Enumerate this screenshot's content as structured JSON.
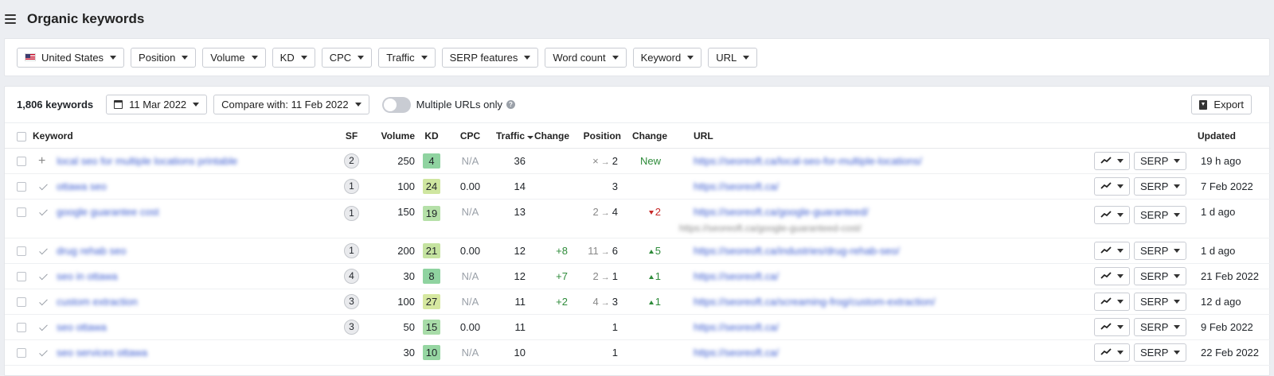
{
  "header": {
    "title": "Organic keywords"
  },
  "filters": [
    {
      "label": "United States",
      "icon": "us-flag-icon"
    },
    {
      "label": "Position"
    },
    {
      "label": "Volume"
    },
    {
      "label": "KD"
    },
    {
      "label": "CPC"
    },
    {
      "label": "Traffic"
    },
    {
      "label": "SERP features"
    },
    {
      "label": "Word count"
    },
    {
      "label": "Keyword"
    },
    {
      "label": "URL"
    }
  ],
  "toolbar": {
    "keyword_count": "1,806 keywords",
    "date": "11 Mar 2022",
    "compare": "Compare with: 11 Feb 2022",
    "multiple_urls_label": "Multiple URLs only",
    "multiple_urls_on": false,
    "export_label": "Export"
  },
  "columns": {
    "keyword": "Keyword",
    "sf": "SF",
    "volume": "Volume",
    "kd": "KD",
    "cpc": "CPC",
    "traffic": "Traffic",
    "traffic_change": "Change",
    "position": "Position",
    "position_change": "Change",
    "url": "URL",
    "updated": "Updated"
  },
  "row_actions": {
    "serp_label": "SERP"
  },
  "rows": [
    {
      "marker": "plus",
      "keyword": "local seo for multiple locations printable",
      "sf": "2",
      "volume": "250",
      "kd": "4",
      "kd_color": "#8fd3a0",
      "cpc": "N/A",
      "traffic": "36",
      "traffic_change": "",
      "pos_from": "×",
      "pos_to": "2",
      "pos_change": "New",
      "pos_dir": "new",
      "url": "https://seoreoft.ca/local-seo-for-multiple-locations/",
      "sub_url": "",
      "updated": "19 h ago"
    },
    {
      "marker": "check",
      "keyword": "ottawa seo",
      "sf": "1",
      "volume": "100",
      "kd": "24",
      "kd_color": "#cfe6a0",
      "cpc": "0.00",
      "traffic": "14",
      "traffic_change": "",
      "pos_from": "",
      "pos_to": "3",
      "pos_change": "",
      "pos_dir": "",
      "url": "https://seoreoft.ca/",
      "sub_url": "",
      "updated": "7 Feb 2022"
    },
    {
      "marker": "check",
      "keyword": "google guarantee cost",
      "sf": "1",
      "volume": "150",
      "kd": "19",
      "kd_color": "#b5e0a8",
      "cpc": "N/A",
      "traffic": "13",
      "traffic_change": "",
      "pos_from": "2",
      "pos_to": "4",
      "pos_change": "2",
      "pos_dir": "down",
      "url": "https://seoreoft.ca/google-guaranteed/",
      "sub_url": "https://seoreoft.ca/google-guaranteed-cost/",
      "updated": "1 d ago"
    },
    {
      "marker": "check",
      "keyword": "drug rehab seo",
      "sf": "1",
      "volume": "200",
      "kd": "21",
      "kd_color": "#c5e3a0",
      "cpc": "0.00",
      "traffic": "12",
      "traffic_change": "+8",
      "pos_from": "11",
      "pos_to": "6",
      "pos_change": "5",
      "pos_dir": "up",
      "url": "https://seoreoft.ca/industries/drug-rehab-seo/",
      "sub_url": "",
      "updated": "1 d ago"
    },
    {
      "marker": "check",
      "keyword": "seo in ottawa",
      "sf": "4",
      "volume": "30",
      "kd": "8",
      "kd_color": "#8fd3a0",
      "cpc": "N/A",
      "traffic": "12",
      "traffic_change": "+7",
      "pos_from": "2",
      "pos_to": "1",
      "pos_change": "1",
      "pos_dir": "up",
      "url": "https://seoreoft.ca/",
      "sub_url": "",
      "updated": "21 Feb 2022"
    },
    {
      "marker": "check",
      "keyword": "custom extraction",
      "sf": "3",
      "volume": "100",
      "kd": "27",
      "kd_color": "#d6e8a0",
      "cpc": "N/A",
      "traffic": "11",
      "traffic_change": "+2",
      "pos_from": "4",
      "pos_to": "3",
      "pos_change": "1",
      "pos_dir": "up",
      "url": "https://seoreoft.ca/screaming-frog/custom-extraction/",
      "sub_url": "",
      "updated": "12 d ago"
    },
    {
      "marker": "check",
      "keyword": "seo ottawa",
      "sf": "3",
      "volume": "50",
      "kd": "15",
      "kd_color": "#a8dca8",
      "cpc": "0.00",
      "traffic": "11",
      "traffic_change": "",
      "pos_from": "",
      "pos_to": "1",
      "pos_change": "",
      "pos_dir": "",
      "url": "https://seoreoft.ca/",
      "sub_url": "",
      "updated": "9 Feb 2022"
    },
    {
      "marker": "check",
      "keyword": "seo services ottawa",
      "sf": "",
      "volume": "30",
      "kd": "10",
      "kd_color": "#96d6a2",
      "cpc": "N/A",
      "traffic": "10",
      "traffic_change": "",
      "pos_from": "",
      "pos_to": "1",
      "pos_change": "",
      "pos_dir": "",
      "url": "https://seoreoft.ca/",
      "sub_url": "",
      "updated": "22 Feb 2022"
    }
  ]
}
